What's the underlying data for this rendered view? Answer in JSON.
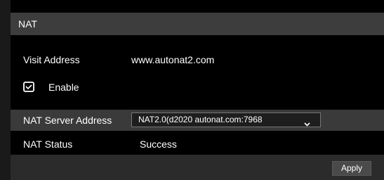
{
  "header": {
    "title": "NAT"
  },
  "visit": {
    "label": "Visit Address",
    "value": "www.autonat2.com"
  },
  "enable": {
    "label": "Enable",
    "checked": true
  },
  "server": {
    "label": "NAT Server Address",
    "selected": "NAT2.0(d2020 autonat.com:7968"
  },
  "status": {
    "label": "NAT Status",
    "value": "Success"
  },
  "footer": {
    "apply_label": "Apply"
  },
  "colors": {
    "background": "#000000",
    "header_bg": "#3d3d3d",
    "row_highlight": "#3a3a3a",
    "footer_bg": "#2b2b2b",
    "text": "#ffffff"
  }
}
